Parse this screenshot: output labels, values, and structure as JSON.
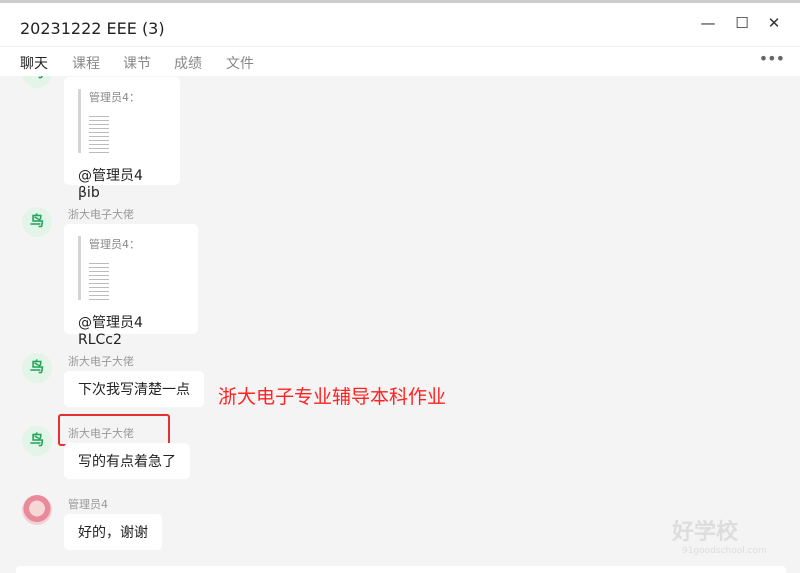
{
  "window": {
    "title": "20231222 EEE (3)",
    "minimize": "—",
    "maximize": "☐",
    "close": "✕"
  },
  "tabs": [
    {
      "label": "聊天",
      "active": true
    },
    {
      "label": "课程"
    },
    {
      "label": "课节"
    },
    {
      "label": "成绩"
    },
    {
      "label": "文件"
    }
  ],
  "more": "•••",
  "messages": [
    {
      "sender": "",
      "avatar": "鸟",
      "quote_name": "管理员4：",
      "text": "@管理员4 βib"
    },
    {
      "sender": "浙大电子大佬",
      "avatar": "鸟",
      "quote_name": "管理员4：",
      "text": "@管理员4 RLCc2"
    },
    {
      "sender": "浙大电子大佬",
      "avatar": "鸟",
      "text": "下次我写清楚一点"
    },
    {
      "sender": "浙大电子大佬",
      "avatar": "鸟",
      "text": "写的有点着急了"
    },
    {
      "sender": "管理员4",
      "text": "好的，谢谢"
    }
  ],
  "annotation": "浙大电子专业辅导本科作业",
  "watermark": {
    "text": "好学校",
    "url_text": "91goodschool.com"
  },
  "colors": {
    "accent": "#1aa260",
    "annotation": "#ff2222"
  }
}
